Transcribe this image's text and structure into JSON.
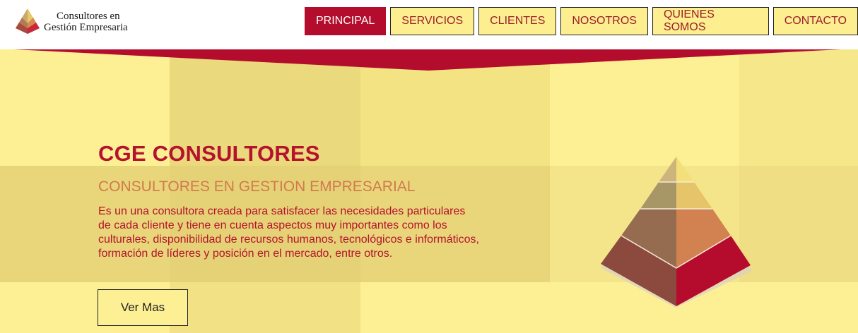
{
  "brand": {
    "line1": "Consultores en",
    "line2": "Gestión Empresaria",
    "logo_icon": "pyramid-logo-icon"
  },
  "nav": {
    "items": [
      {
        "label": "PRINCIPAL",
        "active": true
      },
      {
        "label": "SERVICIOS",
        "active": false
      },
      {
        "label": "CLIENTES",
        "active": false
      },
      {
        "label": "NOSOTROS",
        "active": false
      },
      {
        "label": "QUIENES SOMOS",
        "active": false
      },
      {
        "label": "CONTACTO",
        "active": false
      }
    ]
  },
  "hero": {
    "title": "CGE CONSULTORES",
    "subtitle": "CONSULTORES EN GESTION EMPRESARIAL",
    "description": "Es un una consultora creada para satisfacer las necesidades particulares de cada cliente y tiene en cuenta aspectos muy importantes como los culturales, disponibilidad de recursos humanos, tecnológicos e informáticos, formación de líderes y posición en el mercado, entre otros.",
    "cta_label": "Ver Mas",
    "illustration": "pyramid-illustration"
  },
  "colors": {
    "accent": "#b30c2c",
    "nav_bg": "#fdef8f",
    "hero_bg": "#fdef94",
    "subtitle": "#cf7a4f"
  }
}
